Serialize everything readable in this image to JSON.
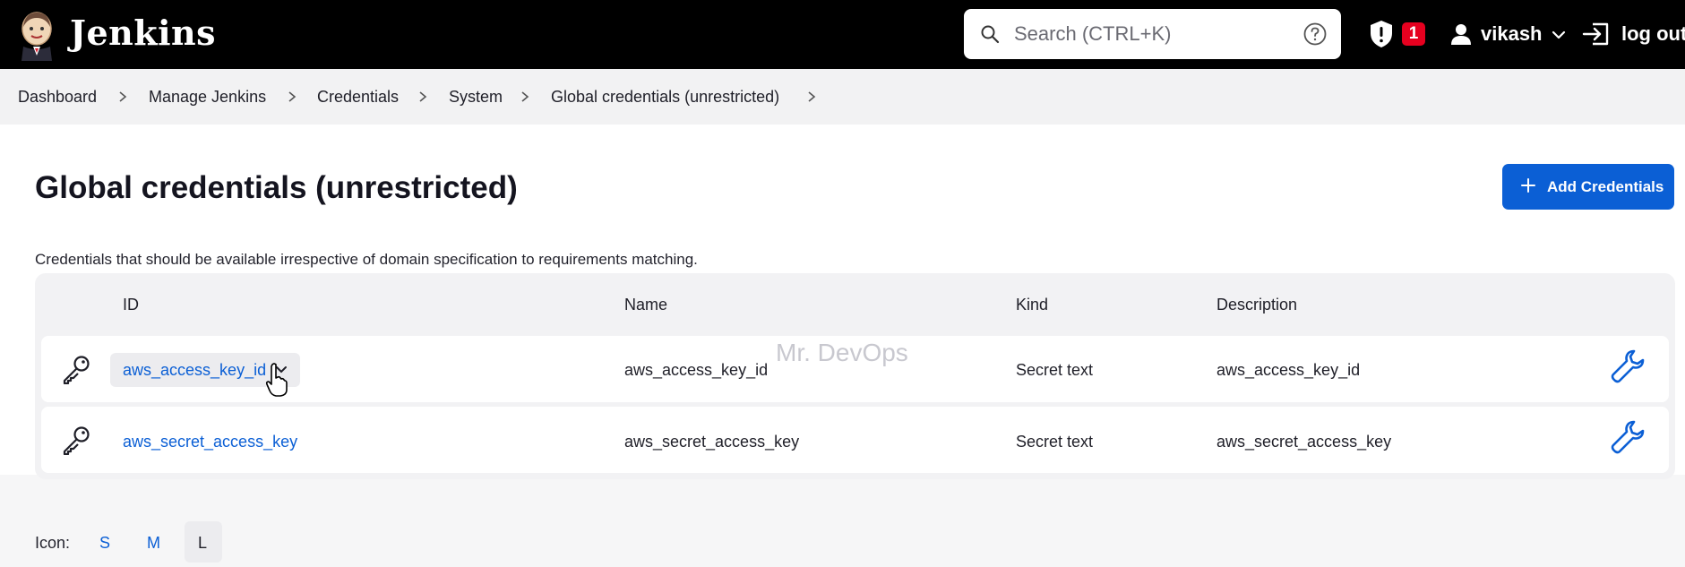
{
  "header": {
    "brand": "Jenkins",
    "search_placeholder": "Search (CTRL+K)",
    "security_badge_count": "1",
    "username": "vikash",
    "logout_label": "log out"
  },
  "breadcrumb": {
    "items": [
      "Dashboard",
      "Manage Jenkins",
      "Credentials",
      "System",
      "Global credentials (unrestricted)"
    ]
  },
  "page": {
    "title": "Global credentials (unrestricted)",
    "add_button_label": "Add Credentials",
    "description": "Credentials that should be available irrespective of domain specification to requirements matching.",
    "watermark": "Mr. DevOps"
  },
  "table": {
    "columns": [
      "ID",
      "Name",
      "Kind",
      "Description"
    ],
    "rows": [
      {
        "id": "aws_access_key_id",
        "name": "aws_access_key_id",
        "kind": "Secret text",
        "description": "aws_access_key_id"
      },
      {
        "id": "aws_secret_access_key",
        "name": "aws_secret_access_key",
        "kind": "Secret text",
        "description": "aws_secret_access_key"
      }
    ]
  },
  "icon_size": {
    "label": "Icon:",
    "options": [
      "S",
      "M",
      "L"
    ],
    "selected": "L"
  },
  "colors": {
    "accent": "#0b5fd5",
    "header_bg": "#000000",
    "badge_red": "#e6001f"
  }
}
